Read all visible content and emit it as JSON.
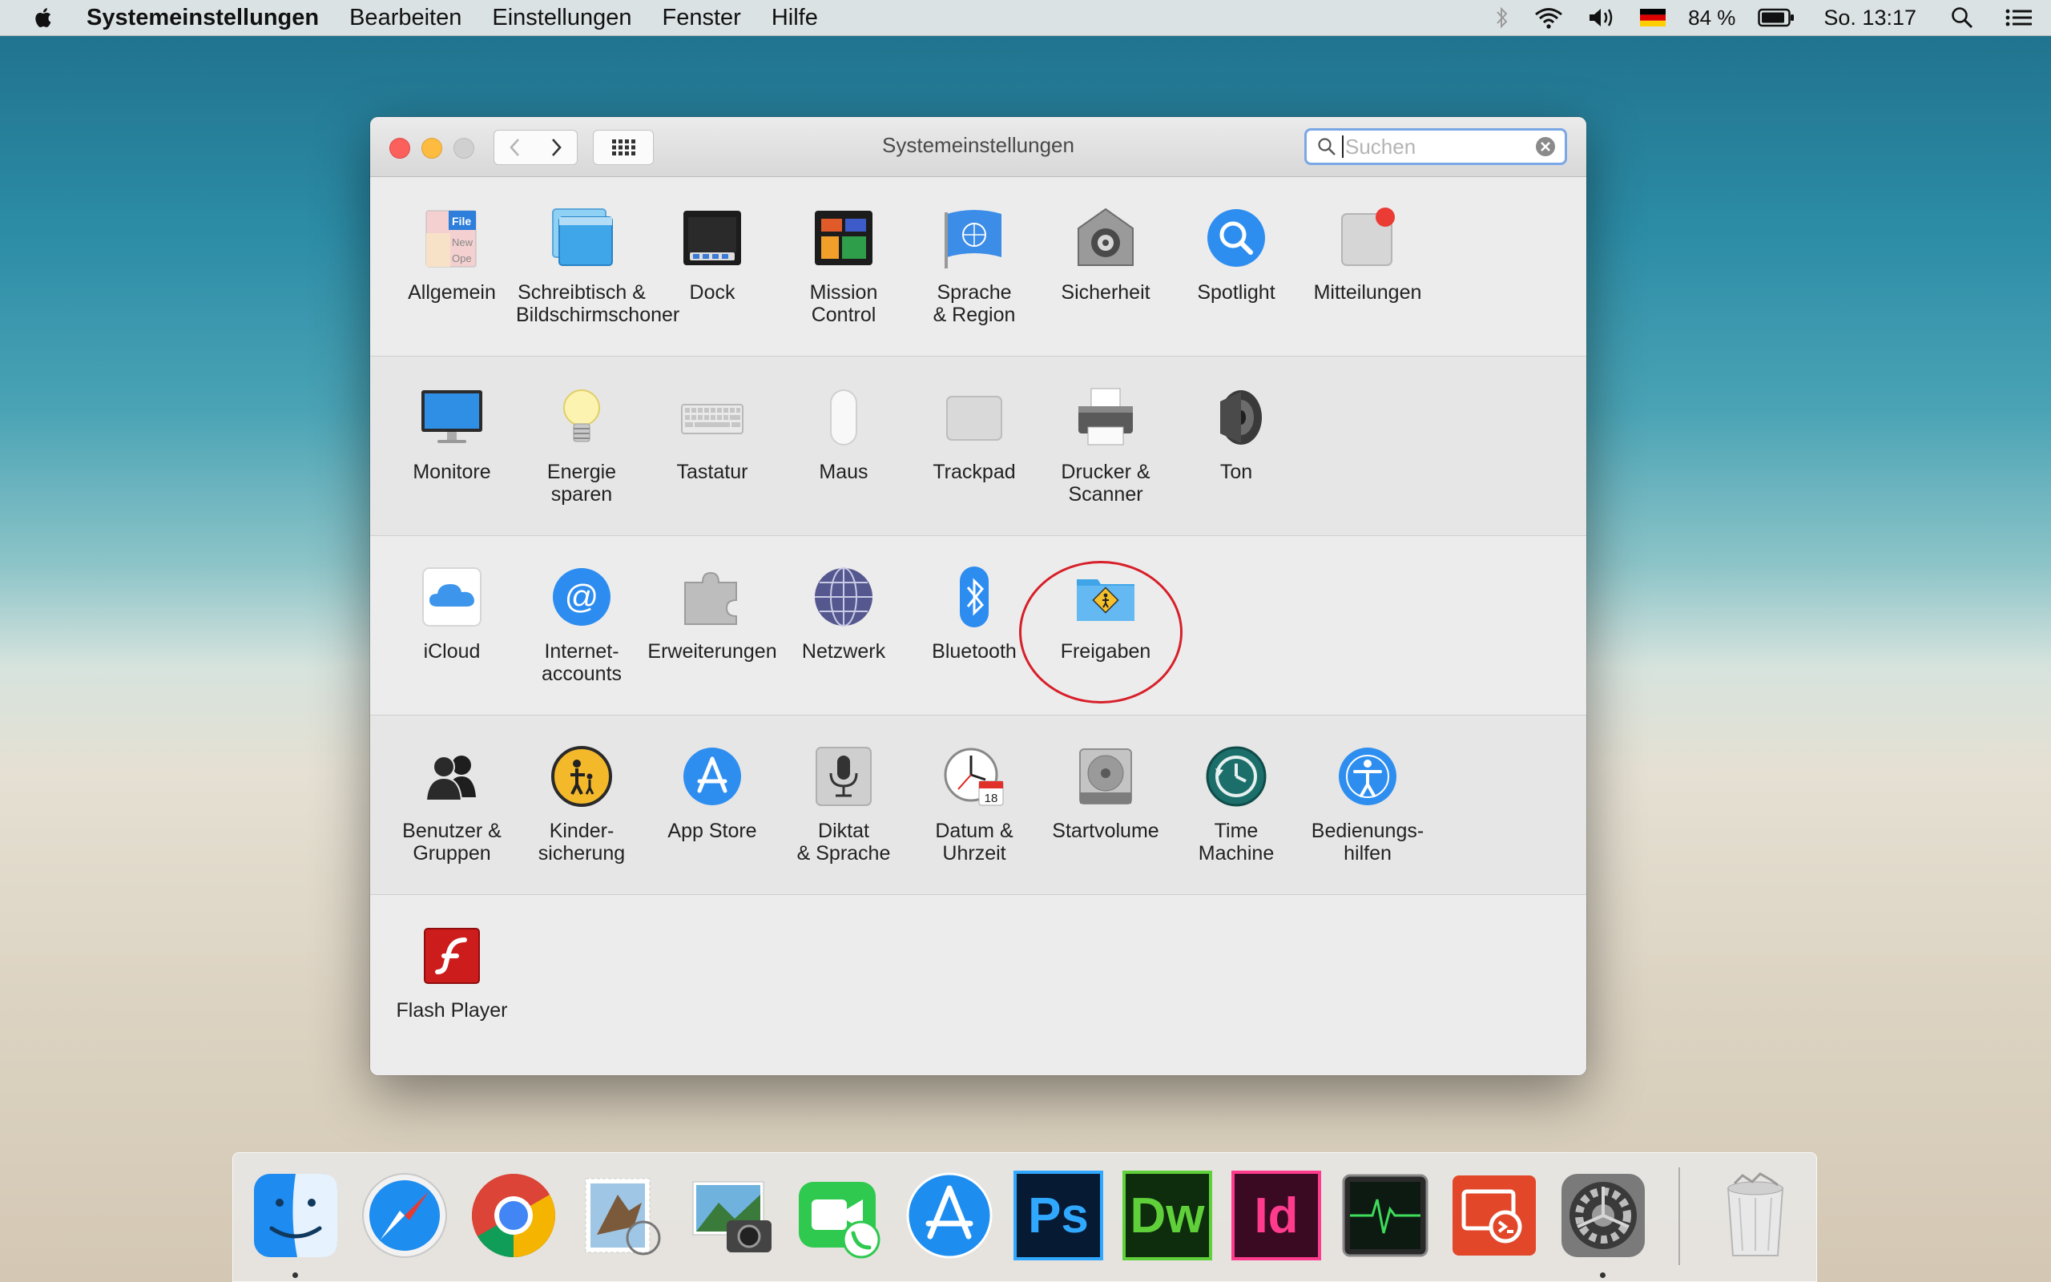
{
  "menubar": {
    "app_name": "Systemeinstellungen",
    "menus": [
      "Bearbeiten",
      "Einstellungen",
      "Fenster",
      "Hilfe"
    ],
    "battery": "84 %",
    "clock": "So. 13:17"
  },
  "window": {
    "title": "Systemeinstellungen",
    "search_placeholder": "Suchen"
  },
  "sections": [
    [
      {
        "label": "Allgemein",
        "icon": "general-icon"
      },
      {
        "label": "Schreibtisch &\nBildschirmschoner",
        "icon": "desktop-screensaver-icon"
      },
      {
        "label": "Dock",
        "icon": "dock-icon"
      },
      {
        "label": "Mission\nControl",
        "icon": "mission-control-icon"
      },
      {
        "label": "Sprache\n& Region",
        "icon": "language-region-icon"
      },
      {
        "label": "Sicherheit",
        "icon": "security-icon"
      },
      {
        "label": "Spotlight",
        "icon": "spotlight-icon"
      },
      {
        "label": "Mitteilungen",
        "icon": "notifications-icon"
      }
    ],
    [
      {
        "label": "Monitore",
        "icon": "displays-icon"
      },
      {
        "label": "Energie\nsparen",
        "icon": "energy-saver-icon"
      },
      {
        "label": "Tastatur",
        "icon": "keyboard-icon"
      },
      {
        "label": "Maus",
        "icon": "mouse-icon"
      },
      {
        "label": "Trackpad",
        "icon": "trackpad-icon"
      },
      {
        "label": "Drucker &\nScanner",
        "icon": "printer-icon"
      },
      {
        "label": "Ton",
        "icon": "sound-icon"
      }
    ],
    [
      {
        "label": "iCloud",
        "icon": "icloud-icon"
      },
      {
        "label": "Internet-\naccounts",
        "icon": "internet-accounts-icon"
      },
      {
        "label": "Erweiterungen",
        "icon": "extensions-icon"
      },
      {
        "label": "Netzwerk",
        "icon": "network-icon"
      },
      {
        "label": "Bluetooth",
        "icon": "bluetooth-icon"
      },
      {
        "label": "Freigaben",
        "icon": "sharing-icon"
      }
    ],
    [
      {
        "label": "Benutzer &\nGruppen",
        "icon": "users-groups-icon"
      },
      {
        "label": "Kinder-\nsicherung",
        "icon": "parental-controls-icon"
      },
      {
        "label": "App Store",
        "icon": "app-store-icon"
      },
      {
        "label": "Diktat\n& Sprache",
        "icon": "dictation-icon"
      },
      {
        "label": "Datum &\nUhrzeit",
        "icon": "date-time-icon"
      },
      {
        "label": "Startvolume",
        "icon": "startup-disk-icon"
      },
      {
        "label": "Time\nMachine",
        "icon": "time-machine-icon"
      },
      {
        "label": "Bedienungs-\nhilfen",
        "icon": "accessibility-icon"
      }
    ],
    [
      {
        "label": "Flash Player",
        "icon": "flash-player-icon"
      }
    ]
  ],
  "calendar_day": "18",
  "dock": {
    "photoshop": "Ps",
    "dreamweaver": "Dw",
    "indesign": "Id"
  },
  "colors": {
    "accent": "#2d87f0",
    "highlight_circle": "#d7202a"
  }
}
